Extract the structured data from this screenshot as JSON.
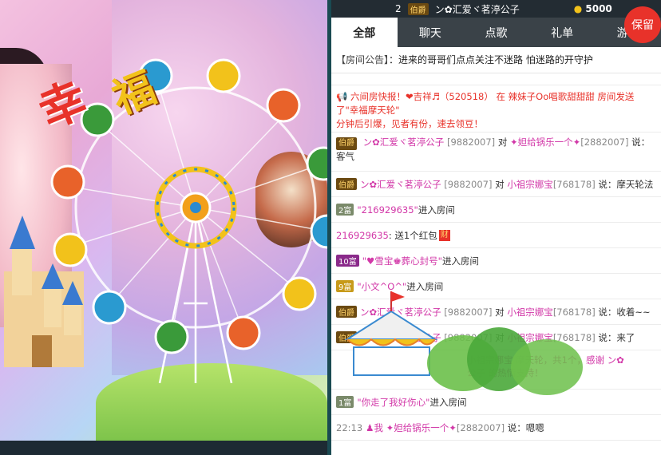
{
  "video": {
    "overlay_text_1": "幸",
    "overlay_text_2": "福"
  },
  "panel": {
    "top_user_rank": "2",
    "top_user_badge": "伯爵",
    "top_user_name": "ン✿汇爱ヾ茗渟公子",
    "top_user_coins": "5000",
    "keep_label": "保留",
    "tabs": [
      "全部",
      "聊天",
      "点歌",
      "礼单",
      "游戏"
    ],
    "announce_label": "【房间公告】",
    "announce_text": "：进来的哥哥们点点关注不迷路 怕迷路的开守护",
    "messages": [
      {
        "type": "broadcast",
        "text": "六间房快报！❤吉祥♬（520518） 在 辣妹子Oo唱歌甜甜甜 房间发送了\"幸福摩天轮\"",
        "text2": "分钟后引爆，见者有份，速去领豆！"
      },
      {
        "type": "chat",
        "badge": "伯爵",
        "from": "ン✿汇爱ヾ茗渟公子",
        "from_id": "[9882007]",
        "verb": "对",
        "to": "✦妲给锅乐一个✦",
        "to_id": "[2882007]",
        "text": "说：",
        "cont": "客气"
      },
      {
        "type": "chat1",
        "badge": "伯爵",
        "from": "ン✿汇爱ヾ茗渟公子",
        "from_id": "[9882007]",
        "verb": "对",
        "to": "小祖宗娜宝",
        "to_id": "[768178]",
        "text": "说：摩天轮法"
      },
      {
        "type": "enter",
        "badge": "2富",
        "name": "\"216929635\"",
        "text": "进入房间"
      },
      {
        "type": "gift",
        "name": "216929635",
        "text": ": 送1个红包",
        "icon": "财"
      },
      {
        "type": "enter",
        "badge": "10富",
        "name": "\"♥雪宝♚葬心封号\"",
        "text": "进入房间"
      },
      {
        "type": "enter",
        "badge": "9富",
        "name": "\"小文^O^\"",
        "text": "进入房间"
      },
      {
        "type": "chat1",
        "badge": "伯爵",
        "from": "ン✿汇爱ヾ茗渟公子",
        "from_id": "[9882007]",
        "verb": "对",
        "to": "小祖宗娜宝",
        "to_id": "[768178]",
        "text": "说：收着~~"
      },
      {
        "type": "chat1",
        "badge": "伯爵",
        "from": "ン✿汇爱ヾ茗渟公子",
        "from_id": "[9882007]",
        "verb": "对",
        "to": "小祖宗娜宝",
        "to_id": "[768178]",
        "text": "说：来了"
      },
      {
        "type": "thanks",
        "text": "小祖宗娜宝 摩天轮，共1个，感谢 ン✿",
        "text2": "公子 的热情支持！"
      },
      {
        "type": "enter",
        "badge": "1富",
        "name": "\"你走了我好伤心\"",
        "text": "进入房间"
      },
      {
        "type": "chat2",
        "ts": "22:13",
        "from": "我",
        "to": "✦妲给锅乐一个✦",
        "to_id": "[2882007]",
        "text": "说：嗯嗯"
      }
    ]
  }
}
